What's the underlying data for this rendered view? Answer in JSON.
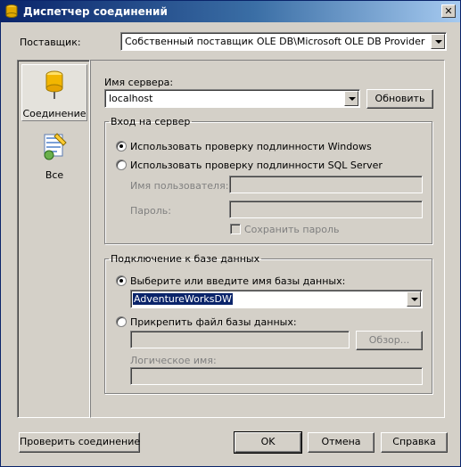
{
  "window": {
    "title": "Диспетчер соединений",
    "close_glyph": "✕"
  },
  "provider": {
    "label": "Поставщик:",
    "value": "Собственный поставщик OLE DB\\Microsoft OLE DB Provider for S..."
  },
  "sidebar": {
    "items": [
      {
        "label": "Соединение",
        "icon": "database-cylinder-icon",
        "selected": true
      },
      {
        "label": "Все",
        "icon": "properties-list-icon",
        "selected": false
      }
    ]
  },
  "server": {
    "label": "Имя сервера:",
    "value": "localhost",
    "refresh_button": "Обновить"
  },
  "login": {
    "group_title": "Вход на сервер",
    "windows_auth": "Использовать проверку подлинности Windows",
    "sql_auth": "Использовать проверку подлинности SQL Server",
    "username_label": "Имя пользователя:",
    "password_label": "Пароль:",
    "save_password": "Сохранить пароль",
    "selected": "windows_auth"
  },
  "database": {
    "group_title": "Подключение к базе данных",
    "select_db_label": "Выберите или введите имя базы данных:",
    "db_value": "AdventureWorksDW",
    "attach_label": "Прикрепить файл базы данных:",
    "browse_button": "Обзор...",
    "logical_name_label": "Логическое имя:",
    "selected": "select_db"
  },
  "footer": {
    "test_button": "Проверить соединение",
    "ok_button": "OK",
    "cancel_button": "Отмена",
    "help_button": "Справка"
  },
  "colors": {
    "titlebar_start": "#0a246a",
    "titlebar_end": "#a6caf0",
    "face": "#d4d0c8",
    "selection": "#0a246a"
  }
}
